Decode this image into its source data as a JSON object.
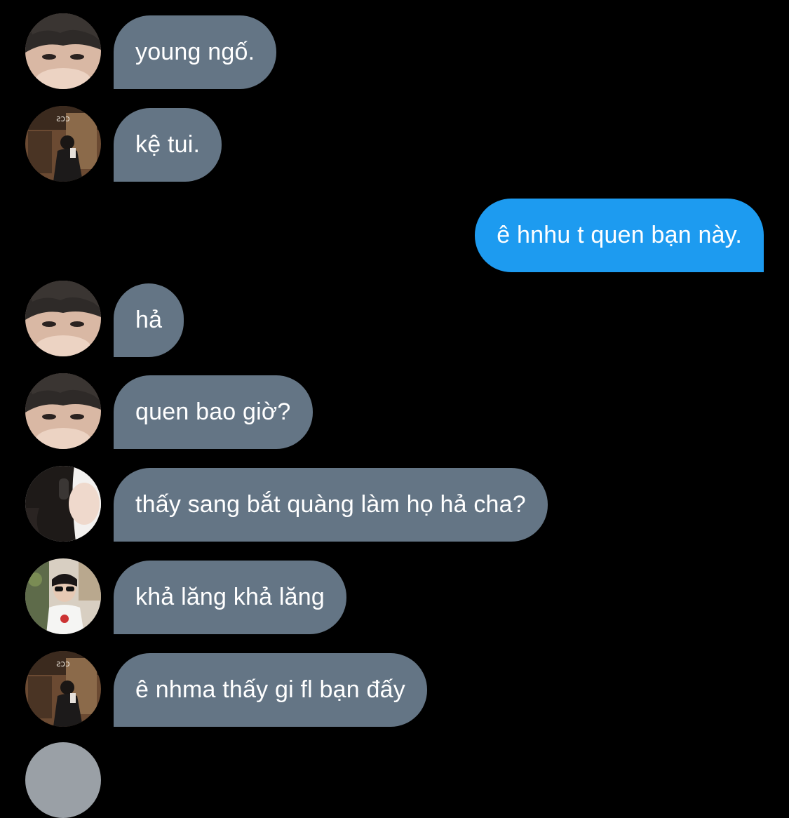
{
  "messages": [
    {
      "direction": "in",
      "avatar": "avatar-boy-face-closeup",
      "text": "young ngố."
    },
    {
      "direction": "in",
      "avatar": "avatar-boy-mirror-selfie",
      "text": "kệ tui."
    },
    {
      "direction": "out",
      "text": "ê hnhu t quen bạn này."
    },
    {
      "direction": "in",
      "avatar": "avatar-boy-face-closeup",
      "text": "hả"
    },
    {
      "direction": "in",
      "avatar": "avatar-boy-face-closeup",
      "text": "quen bao giờ?"
    },
    {
      "direction": "in",
      "avatar": "avatar-girl-headphones",
      "text": "thấy sang bắt quàng làm họ hả cha?"
    },
    {
      "direction": "in",
      "avatar": "avatar-girl-sunglasses",
      "text": "khả lăng khả lăng"
    },
    {
      "direction": "in",
      "avatar": "avatar-boy-mirror-selfie",
      "text": "ê nhma thấy gi fl bạn đấy"
    }
  ],
  "colors": {
    "background": "#000000",
    "incoming_bubble": "#647585",
    "outgoing_bubble": "#1d9bf0",
    "text": "#ffffff"
  }
}
